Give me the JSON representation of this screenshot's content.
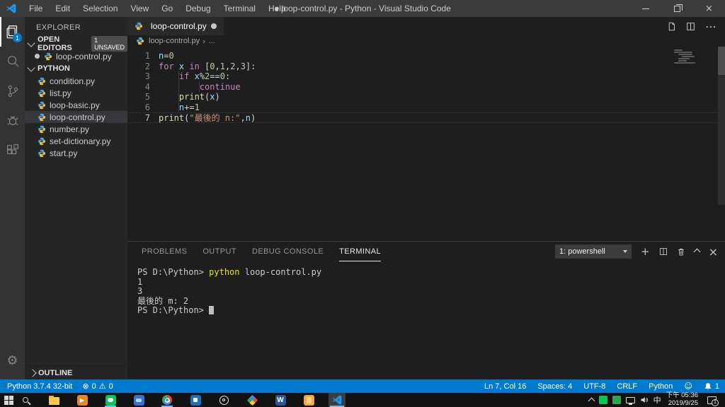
{
  "colors": {
    "accent": "#007acc",
    "keyword": "#c586c0",
    "function": "#dcdcaa",
    "number": "#b5cea8",
    "string": "#ce9178",
    "variable": "#9cdcfe",
    "command_yellow": "#e5e510",
    "statusbar": "#007acc"
  },
  "window": {
    "title": "● loop-control.py - Python - Visual Studio Code",
    "menus": [
      "File",
      "Edit",
      "Selection",
      "View",
      "Go",
      "Debug",
      "Terminal",
      "Help"
    ]
  },
  "activity_bar": {
    "explorer_badge": "1"
  },
  "sidebar": {
    "title": "EXPLORER",
    "open_editors": {
      "label": "OPEN EDITORS",
      "badge": "1 UNSAVED",
      "items": [
        {
          "name": "loop-control.py",
          "modified": true
        }
      ]
    },
    "folder": {
      "label": "PYTHON",
      "files": [
        "condition.py",
        "list.py",
        "loop-basic.py",
        "loop-control.py",
        "number.py",
        "set-dictionary.py",
        "start.py"
      ],
      "selected": "loop-control.py"
    },
    "outline_label": "OUTLINE"
  },
  "editor": {
    "tab": {
      "label": "loop-control.py",
      "modified": true
    },
    "breadcrumb": {
      "file": "loop-control.py",
      "more": "..."
    },
    "lines": [
      {
        "num": "1",
        "indent": 0,
        "segs": [
          {
            "t": "n",
            "c": "var"
          },
          {
            "t": "=",
            "c": "op"
          },
          {
            "t": "0",
            "c": "num"
          }
        ]
      },
      {
        "num": "2",
        "indent": 0,
        "segs": [
          {
            "t": "for",
            "c": "kw"
          },
          {
            "t": " ",
            "c": "op"
          },
          {
            "t": "x",
            "c": "var"
          },
          {
            "t": " ",
            "c": "op"
          },
          {
            "t": "in",
            "c": "kw"
          },
          {
            "t": " [",
            "c": "op"
          },
          {
            "t": "0",
            "c": "num"
          },
          {
            "t": ",",
            "c": "op"
          },
          {
            "t": "1",
            "c": "num"
          },
          {
            "t": ",",
            "c": "op"
          },
          {
            "t": "2",
            "c": "num"
          },
          {
            "t": ",",
            "c": "op"
          },
          {
            "t": "3",
            "c": "num"
          },
          {
            "t": "]:",
            "c": "op"
          }
        ]
      },
      {
        "num": "3",
        "indent": 1,
        "segs": [
          {
            "t": "if",
            "c": "kw"
          },
          {
            "t": " ",
            "c": "op"
          },
          {
            "t": "x",
            "c": "var"
          },
          {
            "t": "%",
            "c": "op"
          },
          {
            "t": "2",
            "c": "num"
          },
          {
            "t": "==",
            "c": "op"
          },
          {
            "t": "0",
            "c": "num"
          },
          {
            "t": ":",
            "c": "op"
          }
        ]
      },
      {
        "num": "4",
        "indent": 2,
        "segs": [
          {
            "t": "continue",
            "c": "kw"
          }
        ]
      },
      {
        "num": "5",
        "indent": 1,
        "segs": [
          {
            "t": "print",
            "c": "fn"
          },
          {
            "t": "(",
            "c": "op"
          },
          {
            "t": "x",
            "c": "var"
          },
          {
            "t": ")",
            "c": "op"
          }
        ]
      },
      {
        "num": "6",
        "indent": 1,
        "segs": [
          {
            "t": "n",
            "c": "var"
          },
          {
            "t": "+=",
            "c": "op"
          },
          {
            "t": "1",
            "c": "num"
          }
        ]
      },
      {
        "num": "7",
        "indent": 0,
        "current": true,
        "segs": [
          {
            "t": "print",
            "c": "fn"
          },
          {
            "t": "(",
            "c": "op"
          },
          {
            "t": "\"最後的 n:\"",
            "c": "str"
          },
          {
            "t": ",",
            "c": "op"
          },
          {
            "t": "n",
            "c": "var"
          },
          {
            "t": ")",
            "c": "op"
          }
        ]
      }
    ]
  },
  "panel": {
    "tabs": [
      "PROBLEMS",
      "OUTPUT",
      "DEBUG CONSOLE",
      "TERMINAL"
    ],
    "active_tab": "TERMINAL",
    "shell_select": "1: powershell",
    "terminal_lines": [
      {
        "segs": [
          {
            "t": "PS D:\\Python> ",
            "c": "plain"
          },
          {
            "t": "python",
            "c": "cmd"
          },
          {
            "t": " loop-control.py",
            "c": "plain"
          }
        ]
      },
      {
        "segs": [
          {
            "t": "1",
            "c": "plain"
          }
        ]
      },
      {
        "segs": [
          {
            "t": "3",
            "c": "plain"
          }
        ]
      },
      {
        "segs": [
          {
            "t": "最後的 m: 2",
            "c": "plain"
          }
        ]
      },
      {
        "segs": [
          {
            "t": "PS D:\\Python> ",
            "c": "plain"
          }
        ],
        "cursor": true
      }
    ]
  },
  "status_bar": {
    "python_version": "Python 3.7.4 32-bit",
    "errors": "0",
    "warnings": "0",
    "right_items": [
      "Ln 7, Col 16",
      "Spaces: 4",
      "UTF-8",
      "CRLF",
      "Python"
    ],
    "bell_count": "1"
  },
  "taskbar": {
    "ime": "中",
    "clock_time": "下午 05:36",
    "clock_date": "2019/9/25",
    "action_badge": "1"
  }
}
